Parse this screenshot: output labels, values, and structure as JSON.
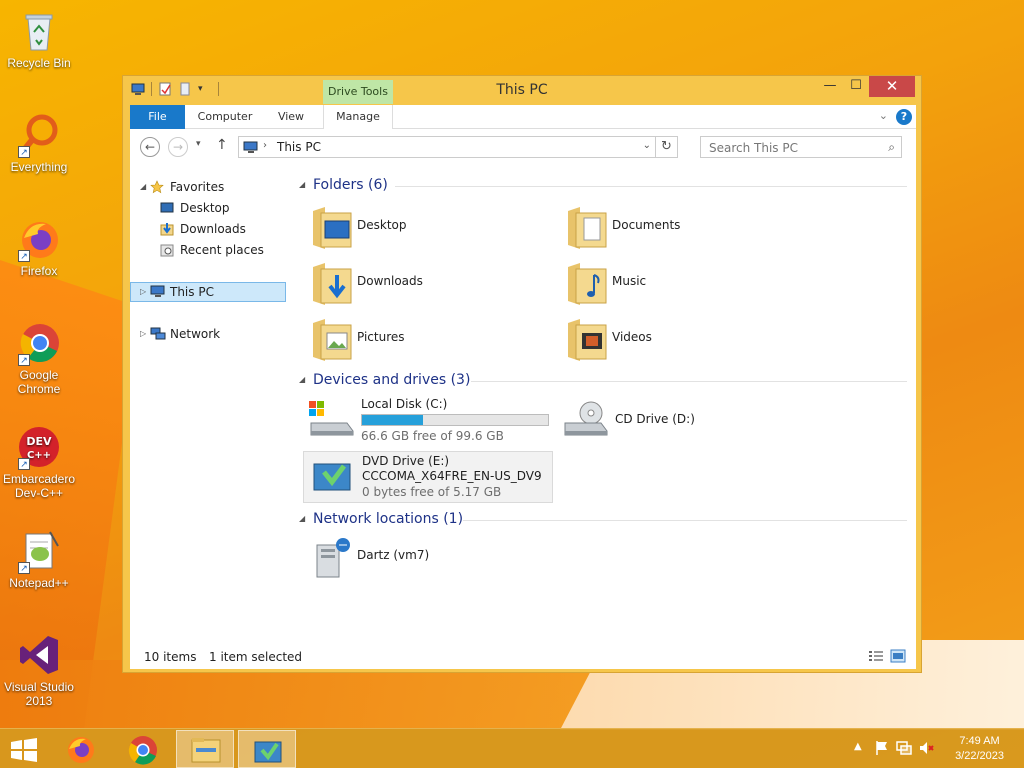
{
  "desktop": {
    "icons": [
      {
        "label": "Recycle Bin"
      },
      {
        "label": "Everything"
      },
      {
        "label": "Firefox"
      },
      {
        "label": "Google Chrome"
      },
      {
        "label": "Embarcadero Dev-C++"
      },
      {
        "label": "Notepad++"
      },
      {
        "label": "Visual Studio 2013"
      }
    ]
  },
  "window": {
    "title": "This PC",
    "context_tab_group": "Drive Tools",
    "ribbon_tabs": [
      "File",
      "Computer",
      "View",
      "Manage"
    ],
    "controls": {
      "minimize": "—",
      "maximize": "☐",
      "close": "✕"
    },
    "help": "?"
  },
  "navigation": {
    "breadcrumb": "This PC",
    "search_placeholder": "Search This PC"
  },
  "sidebar": {
    "favorites": "Favorites",
    "favorite_items": [
      "Desktop",
      "Downloads",
      "Recent places"
    ],
    "this_pc": "This PC",
    "network": "Network"
  },
  "groups": {
    "folders": "Folders (6)",
    "devices": "Devices and drives (3)",
    "network": "Network locations (1)"
  },
  "folders": [
    "Desktop",
    "Documents",
    "Downloads",
    "Music",
    "Pictures",
    "Videos"
  ],
  "drives": [
    {
      "name": "Local Disk (C:)",
      "free": "66.6 GB free of 99.6 GB",
      "used_fraction": 0.33
    },
    {
      "name": "CD Drive (D:)"
    },
    {
      "name": "DVD Drive (E:)",
      "label": "CCCOMA_X64FRE_EN-US_DV9",
      "free": "0 bytes free of 5.17 GB"
    }
  ],
  "network_locations": [
    "Dartz (vm7)"
  ],
  "status": {
    "item_count": "10 items",
    "selection": "1 item selected"
  },
  "taskbar": {
    "time": "7:49 AM",
    "date": "3/22/2023"
  },
  "colors": {
    "accent": "#1979ca",
    "titlebar": "#f6c64a",
    "drive_bar": "#26a0da",
    "close": "#c94848"
  }
}
